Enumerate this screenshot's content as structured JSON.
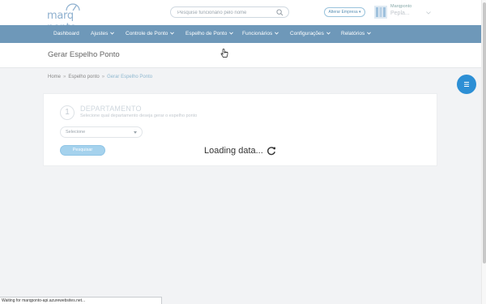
{
  "header": {
    "logo_text": "marq ponto",
    "search_placeholder": "Pesquise funcionário pelo nome",
    "alter_company_label": "Alterar Empresa ▾",
    "user_name": "Marqponto",
    "user_sub": "Pepla..."
  },
  "nav": {
    "items": [
      {
        "label": "Dashboard"
      },
      {
        "label": "Ajustes"
      },
      {
        "label": "Controle de Ponto"
      },
      {
        "label": "Espelho de Ponto"
      },
      {
        "label": "Funcionários"
      },
      {
        "label": "Configurações"
      },
      {
        "label": "Relatórios"
      }
    ]
  },
  "page": {
    "title": "Gerar Espelho Ponto",
    "breadcrumb": [
      "Home",
      "Espelho ponto",
      "Gerar Espelho Ponto"
    ]
  },
  "step": {
    "number": "1",
    "title": "DEPARTAMENTO",
    "description": "Selecione qual departamento deseja gerar o espelho ponto",
    "select_value": "Selecione",
    "button_label": "Pesquisar"
  },
  "loading_text": "Loading data...",
  "status_text": "Waiting for marqponto-api.azurewebsites.net...",
  "colors": {
    "nav_bg": "#6e98b9",
    "accent": "#2d8fd5",
    "button_bg": "#a5d2ed"
  },
  "icons": [
    "search-icon",
    "chevron-down-icon",
    "menu-icon",
    "refresh-icon",
    "hand-cursor-icon",
    "avatar-icon"
  ]
}
